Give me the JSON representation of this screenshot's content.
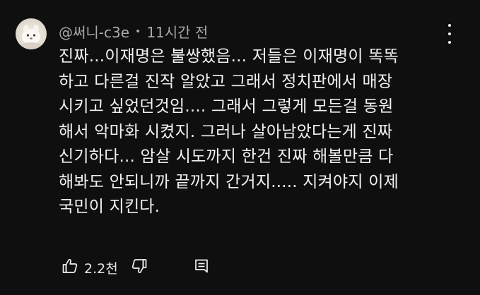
{
  "comment": {
    "author": "@써니-c3e",
    "separator": "•",
    "time": "11시간 전",
    "lines": [
      "진짜...이재명은 불쌍했음... 저들은 이재명이 똑똑",
      "하고 다른걸 진작 알았고 그래서 정치판에서 매장",
      "시키고 싶었던것임.... 그래서 그렇게 모든걸 동원",
      "해서 악마화 시켰지. 그러나 살아남았다는게 진짜",
      "신기하다... 암살 시도까지 한건 진짜 해볼만큼 다",
      "해봐도 안되니까 끝까지 간거지..... 지켜야지 이제",
      "국민이 지킨다."
    ],
    "like_count": "2.2천"
  },
  "icons": {
    "avatar": "avatar-image",
    "menu": "more-vert-icon",
    "like": "thumbs-up-icon",
    "dislike": "thumbs-down-icon",
    "reply": "reply-comment-icon"
  },
  "colors": {
    "background": "#0f0f0f",
    "text": "#f1f1f1",
    "meta": "#aaaaaa"
  }
}
